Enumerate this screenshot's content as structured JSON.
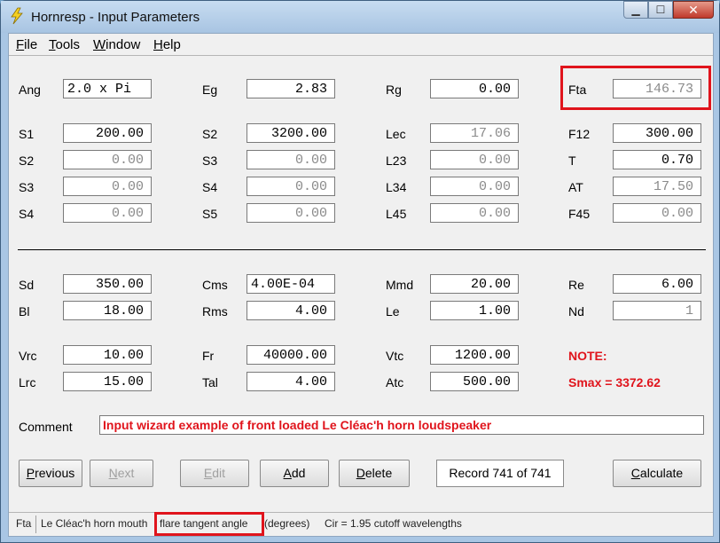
{
  "window": {
    "title": "Hornresp - Input Parameters",
    "app_icon": "lightning-bolt-icon",
    "minimize_glyph": "▁",
    "maximize_glyph": "☐",
    "close_glyph": "✕"
  },
  "menu": [
    "File",
    "Tools",
    "Window",
    "Help"
  ],
  "rows": {
    "r1": [
      {
        "label": "Ang",
        "value": "2.0 x Pi"
      },
      {
        "label": "Eg",
        "value": "2.83"
      },
      {
        "label": "Rg",
        "value": "0.00"
      },
      {
        "label": "Fta",
        "value": "146.73"
      }
    ],
    "r2": [
      {
        "label": "S1",
        "value": "200.00"
      },
      {
        "label": "S2",
        "value": "3200.00"
      },
      {
        "label": "Lec",
        "value": "17.06"
      },
      {
        "label": "F12",
        "value": "300.00"
      }
    ],
    "r3": [
      {
        "label": "S2",
        "value": "0.00"
      },
      {
        "label": "S3",
        "value": "0.00"
      },
      {
        "label": "L23",
        "value": "0.00"
      },
      {
        "label": "T",
        "value": "0.70"
      }
    ],
    "r4": [
      {
        "label": "S3",
        "value": "0.00"
      },
      {
        "label": "S4",
        "value": "0.00"
      },
      {
        "label": "L34",
        "value": "0.00"
      },
      {
        "label": "AT",
        "value": "17.50"
      }
    ],
    "r5": [
      {
        "label": "S4",
        "value": "0.00"
      },
      {
        "label": "S5",
        "value": "0.00"
      },
      {
        "label": "L45",
        "value": "0.00"
      },
      {
        "label": "F45",
        "value": "0.00"
      }
    ],
    "r6": [
      {
        "label": "Sd",
        "value": "350.00"
      },
      {
        "label": "Cms",
        "value": "4.00E-04"
      },
      {
        "label": "Mmd",
        "value": "20.00"
      },
      {
        "label": "Re",
        "value": "6.00"
      }
    ],
    "r7": [
      {
        "label": "Bl",
        "value": "18.00"
      },
      {
        "label": "Rms",
        "value": "4.00"
      },
      {
        "label": "Le",
        "value": "1.00"
      },
      {
        "label": "Nd",
        "value": "1"
      }
    ],
    "r8": [
      {
        "label": "Vrc",
        "value": "10.00"
      },
      {
        "label": "Fr",
        "value": "40000.00"
      },
      {
        "label": "Vtc",
        "value": "1200.00"
      }
    ],
    "r9": [
      {
        "label": "Lrc",
        "value": "15.00"
      },
      {
        "label": "Tal",
        "value": "4.00"
      },
      {
        "label": "Atc",
        "value": "500.00"
      }
    ]
  },
  "note": {
    "label": "NOTE:",
    "smax": "Smax = 3372.62"
  },
  "comment": {
    "label": "Comment",
    "value": "Input wizard example of front loaded Le Cléac'h horn loudspeaker"
  },
  "buttons": {
    "previous": "Previous",
    "next": "Next",
    "edit": "Edit",
    "add": "Add",
    "delete": "Delete",
    "calculate": "Calculate"
  },
  "record": "Record 741 of 741",
  "status": {
    "param": "Fta",
    "desc_a": "Le Cléac'h horn mouth",
    "desc_b": "flare tangent angle",
    "desc_c": "(degrees)",
    "desc_d": "Cir = 1.95 cutoff wavelengths"
  },
  "highlight_color": "#e0141c"
}
